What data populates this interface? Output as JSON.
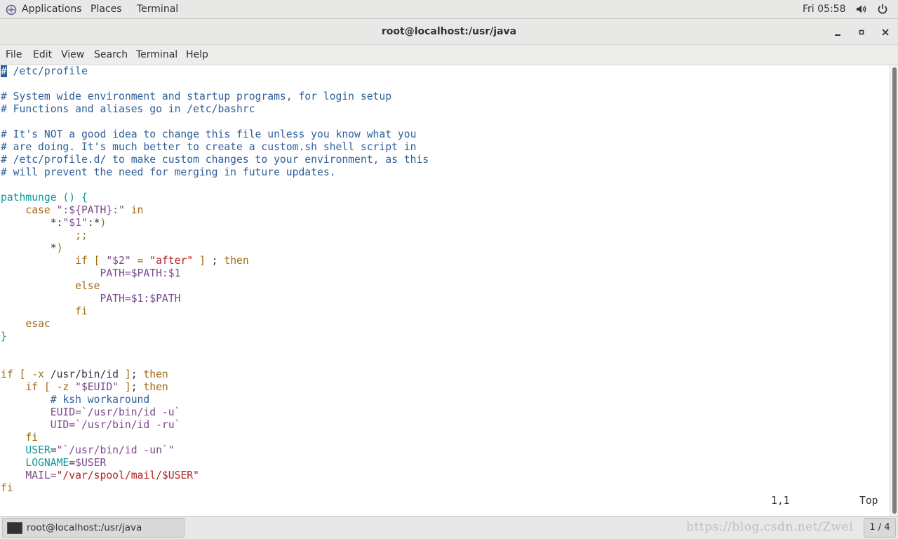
{
  "topbar": {
    "applications": "Applications",
    "places": "Places",
    "terminal": "Terminal",
    "clock": "Fri 05:58",
    "icons": [
      "app-logo-icon",
      "volume-icon",
      "power-icon"
    ]
  },
  "window": {
    "title": "root@localhost:/usr/java",
    "buttons": [
      "minimize-icon",
      "maximize-icon",
      "close-icon"
    ]
  },
  "menubar": {
    "items": [
      "File",
      "Edit",
      "View",
      "Search",
      "Terminal",
      "Help"
    ]
  },
  "editor": {
    "lines": [
      [
        [
          "cursor",
          "#"
        ],
        [
          "c-comment",
          " /etc/profile"
        ]
      ],
      [],
      [
        [
          "c-comment",
          "# System wide environment and startup programs, for login setup"
        ]
      ],
      [
        [
          "c-comment",
          "# Functions and aliases go in /etc/bashrc"
        ]
      ],
      [],
      [
        [
          "c-comment",
          "# It's NOT a good idea to change this file unless you know what you"
        ]
      ],
      [
        [
          "c-comment",
          "# are doing. It's much better to create a custom.sh shell script in"
        ]
      ],
      [
        [
          "c-comment",
          "# /etc/profile.d/ to make custom changes to your environment, as this"
        ]
      ],
      [
        [
          "c-comment",
          "# will prevent the need for merging in future updates."
        ]
      ],
      [],
      [
        [
          "c-func",
          "pathmunge () {"
        ]
      ],
      [
        [
          "c-plain",
          "    "
        ],
        [
          "c-kw",
          "case"
        ],
        [
          "c-plain",
          " "
        ],
        [
          "c-var",
          "\":${PATH}:\""
        ],
        [
          "c-plain",
          " "
        ],
        [
          "c-kw",
          "in"
        ]
      ],
      [
        [
          "c-plain",
          "        *:"
        ],
        [
          "c-var",
          "\"$1\""
        ],
        [
          "c-plain",
          ":*"
        ],
        [
          "c-kw",
          ")"
        ]
      ],
      [
        [
          "c-plain",
          "            "
        ],
        [
          "c-kw",
          ";;"
        ]
      ],
      [
        [
          "c-plain",
          "        *"
        ],
        [
          "c-kw",
          ")"
        ]
      ],
      [
        [
          "c-plain",
          "            "
        ],
        [
          "c-kw",
          "if [ "
        ],
        [
          "c-var",
          "\"$2\""
        ],
        [
          "c-plain",
          " "
        ],
        [
          "c-kw",
          "="
        ],
        [
          "c-plain",
          " "
        ],
        [
          "c-str",
          "\"after\""
        ],
        [
          "c-plain",
          " "
        ],
        [
          "c-kw",
          "]"
        ],
        [
          "c-plain",
          " ; "
        ],
        [
          "c-kw",
          "then"
        ]
      ],
      [
        [
          "c-plain",
          "                "
        ],
        [
          "c-var",
          "PATH=$PATH:$1"
        ]
      ],
      [
        [
          "c-plain",
          "            "
        ],
        [
          "c-kw",
          "else"
        ]
      ],
      [
        [
          "c-plain",
          "                "
        ],
        [
          "c-var",
          "PATH=$1:$PATH"
        ]
      ],
      [
        [
          "c-plain",
          "            "
        ],
        [
          "c-kw",
          "fi"
        ]
      ],
      [
        [
          "c-plain",
          "    "
        ],
        [
          "c-kw",
          "esac"
        ]
      ],
      [
        [
          "c-func",
          "}"
        ]
      ],
      [],
      [],
      [
        [
          "c-kw",
          "if [ -x"
        ],
        [
          "c-plain",
          " /usr/bin/id "
        ],
        [
          "c-kw",
          "]"
        ],
        [
          "c-plain",
          "; "
        ],
        [
          "c-kw",
          "then"
        ]
      ],
      [
        [
          "c-plain",
          "    "
        ],
        [
          "c-kw",
          "if [ -z"
        ],
        [
          "c-plain",
          " "
        ],
        [
          "c-var",
          "\"$EUID\""
        ],
        [
          "c-plain",
          " "
        ],
        [
          "c-kw",
          "]"
        ],
        [
          "c-plain",
          "; "
        ],
        [
          "c-kw",
          "then"
        ]
      ],
      [
        [
          "c-plain",
          "        "
        ],
        [
          "c-comment",
          "# ksh workaround"
        ]
      ],
      [
        [
          "c-plain",
          "        "
        ],
        [
          "c-var",
          "EUID=`/usr/bin/id -u`"
        ]
      ],
      [
        [
          "c-plain",
          "        "
        ],
        [
          "c-var",
          "UID=`/usr/bin/id -ru`"
        ]
      ],
      [
        [
          "c-plain",
          "    "
        ],
        [
          "c-kw",
          "fi"
        ]
      ],
      [
        [
          "c-plain",
          "    "
        ],
        [
          "c-func",
          "USER"
        ],
        [
          "c-plain",
          "="
        ],
        [
          "c-var",
          "\"`/usr/bin/id -un`\""
        ]
      ],
      [
        [
          "c-plain",
          "    "
        ],
        [
          "c-func",
          "LOGNAME"
        ],
        [
          "c-plain",
          "="
        ],
        [
          "c-var",
          "$USER"
        ]
      ],
      [
        [
          "c-plain",
          "    "
        ],
        [
          "c-var",
          "MAIL="
        ],
        [
          "c-str",
          "\"/var/spool/mail/$USER\""
        ]
      ],
      [
        [
          "c-kw",
          "fi"
        ]
      ]
    ],
    "status_position": "1,1",
    "status_scroll": "Top"
  },
  "taskbar": {
    "window_label": "root@localhost:/usr/java",
    "workspace": "1 / 4",
    "watermark": "https://blog.csdn.net/Zwei"
  },
  "colors": {
    "comment": "#2f5f9a",
    "keyword": "#a06a10",
    "function": "#12989a",
    "variable": "#7b4a8e",
    "string": "#b52020",
    "cursor": "#2a5d9e"
  }
}
